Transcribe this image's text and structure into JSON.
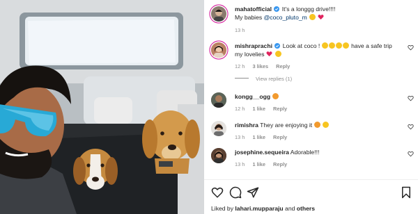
{
  "post": {
    "author": "mahatofficial",
    "caption_text": "It's a longgg drive!!!!",
    "caption_line2_prefix": "My babies ",
    "caption_mention": "@coco_pluto_m",
    "time": "13 h"
  },
  "comments": [
    {
      "user": "mishraprachi",
      "text_prefix": "Look at coco !",
      "text_suffix": "have a safe trip my lovelies",
      "time": "12 h",
      "likes": "3 likes",
      "reply": "Reply",
      "view_replies": "View replies (1)"
    },
    {
      "user": "kongg__ogg",
      "text": "",
      "time": "12 h",
      "likes": "1 like",
      "reply": "Reply"
    },
    {
      "user": "rimishra",
      "text": "They are enjoying it",
      "time": "13 h",
      "likes": "1 like",
      "reply": "Reply"
    },
    {
      "user": "josephine.sequeira",
      "text": "Adorable!!!",
      "time": "13 h",
      "likes": "1 like",
      "reply": "Reply"
    }
  ],
  "footer": {
    "liked_by_prefix": "Liked by",
    "liked_by_user": "lahari.mupparaju",
    "liked_by_join": "and",
    "liked_by_others": "others"
  },
  "icons": {
    "like": "heart-outline-icon",
    "comment": "comment-bubble-icon",
    "share": "paper-plane-icon",
    "save": "bookmark-icon",
    "verified": "verified-badge-icon"
  },
  "colors": {
    "verified": "#3897f0",
    "mention": "#00376b",
    "secondary_text": "#8e8e8e",
    "story_ring": "#d6249f"
  }
}
